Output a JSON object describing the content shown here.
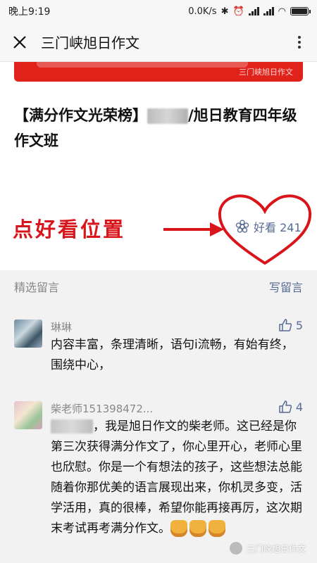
{
  "status_bar": {
    "time": "晚上9:19",
    "network_speed": "0.0K/s"
  },
  "nav": {
    "title": "三门峡旭日作文"
  },
  "banner": {
    "watermark": "三门峡旭日作文"
  },
  "article": {
    "title_prefix": "【满分作文光荣榜】",
    "title_suffix": "/旭日教育四年级作文班"
  },
  "annotation": {
    "text": "点好看位置"
  },
  "like": {
    "label": "好看 241"
  },
  "comments_section": {
    "label": "精选留言",
    "write_label": "写留言",
    "comments": [
      {
        "name": "琳琳",
        "likes": "5",
        "text": "内容丰富，条理清晰，语句i流畅，有始有终，围绕中心，"
      },
      {
        "name": "柴老师151398472...",
        "likes": "4",
        "text": "，我是旭日作文的柴老师。这已经是你第三次获得满分作文了，你心里开心，老师心里也欣慰。你是一个有想法的孩子，这些想法总能随着你那优美的语言展现出来，你机灵多变，活学活用，真的很棒，希望你能再接再厉，这次期末考试再考满分作文。"
      }
    ]
  },
  "watermark": {
    "text": "三门峡旭日作文"
  },
  "colors": {
    "accent_blue": "#576b95",
    "annotation_red": "#d8151b",
    "banner_red": "#e0221b"
  }
}
